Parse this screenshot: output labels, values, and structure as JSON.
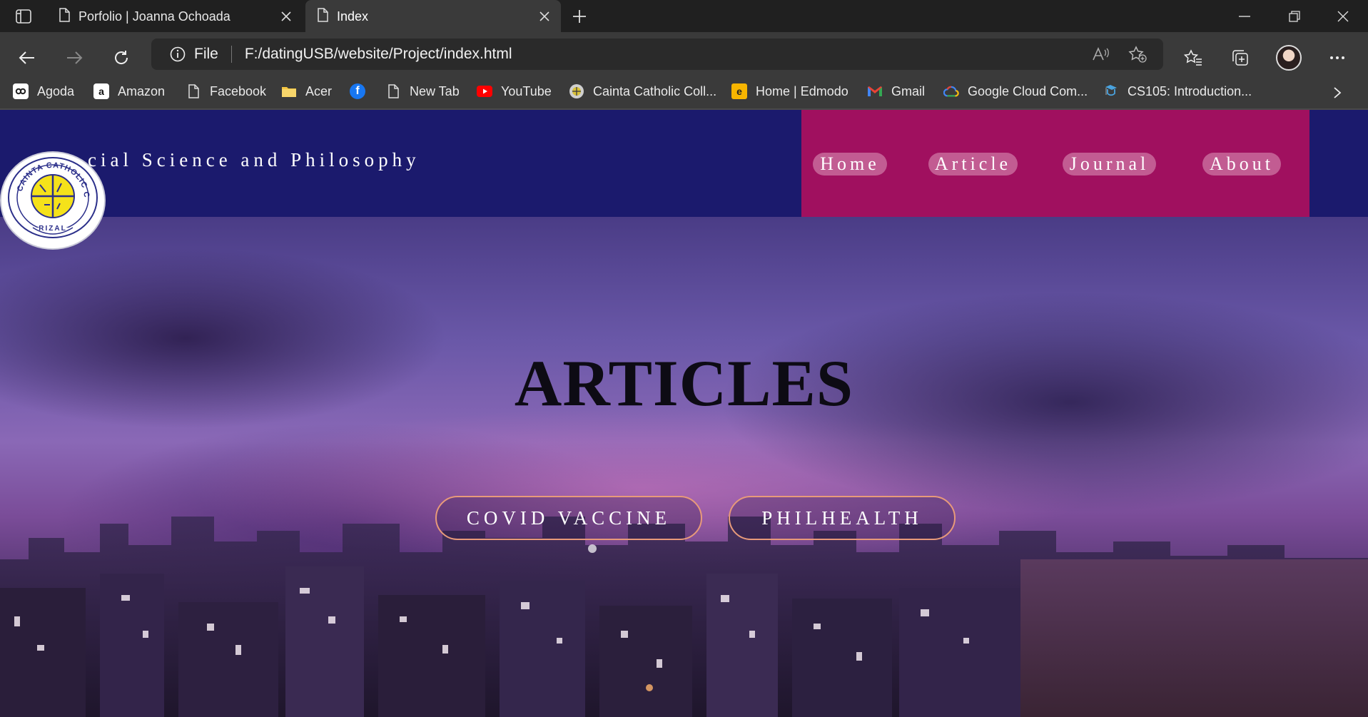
{
  "browser": {
    "tabs": [
      {
        "title": "Porfolio | Joanna Ochoada",
        "active": false
      },
      {
        "title": "Index",
        "active": true
      }
    ],
    "address": {
      "scheme_label": "File",
      "url": "F:/datingUSB/website/Project/index.html"
    },
    "bookmarks": [
      {
        "label": "Agoda",
        "icon": "agoda-icon"
      },
      {
        "label": "Amazon",
        "icon": "amazon-icon"
      },
      {
        "label": "Facebook",
        "icon": "page-icon"
      },
      {
        "label": "Acer",
        "icon": "folder-icon"
      },
      {
        "label": "",
        "icon": "facebook-icon"
      },
      {
        "label": "New Tab",
        "icon": "page-icon"
      },
      {
        "label": "YouTube",
        "icon": "youtube-icon"
      },
      {
        "label": "Cainta Catholic Coll...",
        "icon": "college-icon"
      },
      {
        "label": "Home | Edmodo",
        "icon": "edmodo-icon"
      },
      {
        "label": "Gmail",
        "icon": "gmail-icon"
      },
      {
        "label": "Google Cloud Com...",
        "icon": "google-cloud-icon"
      },
      {
        "label": "CS105: Introduction...",
        "icon": "course-icon"
      }
    ]
  },
  "site": {
    "title": "cial Science and Philosophy",
    "logo": {
      "text_top": "CAINTA CATHOLIC COLLEGE",
      "text_bottom": "RIZAL"
    },
    "nav": [
      {
        "label": "Home"
      },
      {
        "label": "Article"
      },
      {
        "label": "Journal"
      },
      {
        "label": "About"
      }
    ],
    "hero": {
      "title": "ARTICLES",
      "buttons": [
        {
          "label": "COVID VACCINE"
        },
        {
          "label": "PHILHEALTH"
        }
      ]
    }
  },
  "colors": {
    "header_bg": "#1b1a6d",
    "nav_bg": "#a0105f",
    "nav_pill": "#c25c92",
    "hero_button_border": "#e89a7a",
    "browser_dark": "#202020",
    "browser_toolbar": "#3a3a3a"
  }
}
